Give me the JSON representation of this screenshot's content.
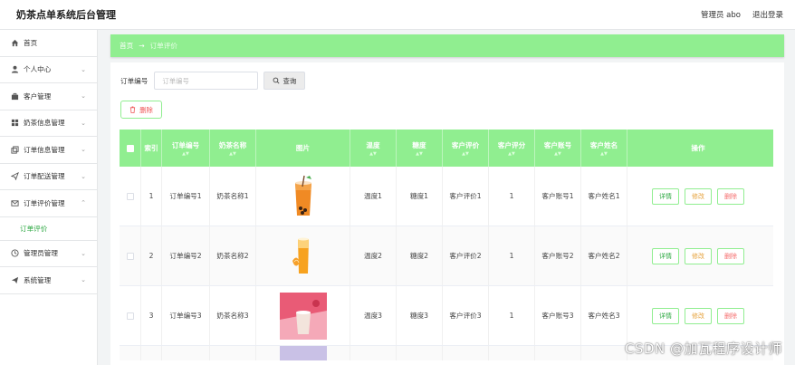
{
  "header": {
    "brand": "奶茶点单系统后台管理",
    "user_label": "管理员 abo",
    "logout_label": "退出登录"
  },
  "sidebar": {
    "items": [
      {
        "label": "首页",
        "icon": "home-icon",
        "has_children": false
      },
      {
        "label": "个人中心",
        "icon": "user-icon",
        "has_children": true
      },
      {
        "label": "客户管理",
        "icon": "briefcase-icon",
        "has_children": true
      },
      {
        "label": "奶茶信息管理",
        "icon": "grid-icon",
        "has_children": true
      },
      {
        "label": "订单信息管理",
        "icon": "copy-icon",
        "has_children": true
      },
      {
        "label": "订单配送管理",
        "icon": "send-icon",
        "has_children": true
      },
      {
        "label": "订单评价管理",
        "icon": "mail-icon",
        "has_children": true,
        "expanded": true
      },
      {
        "label": "管理员管理",
        "icon": "clock-icon",
        "has_children": true
      },
      {
        "label": "系统管理",
        "icon": "plane-icon",
        "has_children": true
      }
    ],
    "active_sub": "订单评价"
  },
  "breadcrumb": {
    "home": "首页",
    "separator": "→",
    "current": "订单评价"
  },
  "search": {
    "label": "订单编号",
    "placeholder": "订单编号",
    "button": "查询"
  },
  "toolbar": {
    "delete_label": "删除"
  },
  "table": {
    "columns": [
      "",
      "索引",
      "订单编号",
      "奶茶名称",
      "图片",
      "温度",
      "糖度",
      "客户评价",
      "客户评分",
      "客户账号",
      "客户姓名",
      "操作"
    ],
    "rows": [
      {
        "index": "1",
        "order_no": "订单编号1",
        "tea_name": "奶茶名称1",
        "image": "orange-tea",
        "temperature": "温度1",
        "sweetness": "糖度1",
        "review": "客户评价1",
        "score": "1",
        "account": "客户账号1",
        "customer": "客户姓名1"
      },
      {
        "index": "2",
        "order_no": "订单编号2",
        "tea_name": "奶茶名称2",
        "image": "orange-juice",
        "temperature": "温度2",
        "sweetness": "糖度2",
        "review": "客户评价2",
        "score": "1",
        "account": "客户账号2",
        "customer": "客户姓名2"
      },
      {
        "index": "3",
        "order_no": "订单编号3",
        "tea_name": "奶茶名称3",
        "image": "pink-milk-tea",
        "temperature": "温度3",
        "sweetness": "糖度3",
        "review": "客户评价3",
        "score": "1",
        "account": "客户账号3",
        "customer": "客户姓名3"
      }
    ],
    "ops": {
      "detail": "详情",
      "edit": "修改",
      "delete": "删除"
    }
  },
  "watermark": "CSDN @加瓦程序设计师",
  "colors": {
    "accent": "#90ee90",
    "active_text": "#2ea843",
    "danger": "#f56c6c",
    "warning": "#e6a23c"
  }
}
